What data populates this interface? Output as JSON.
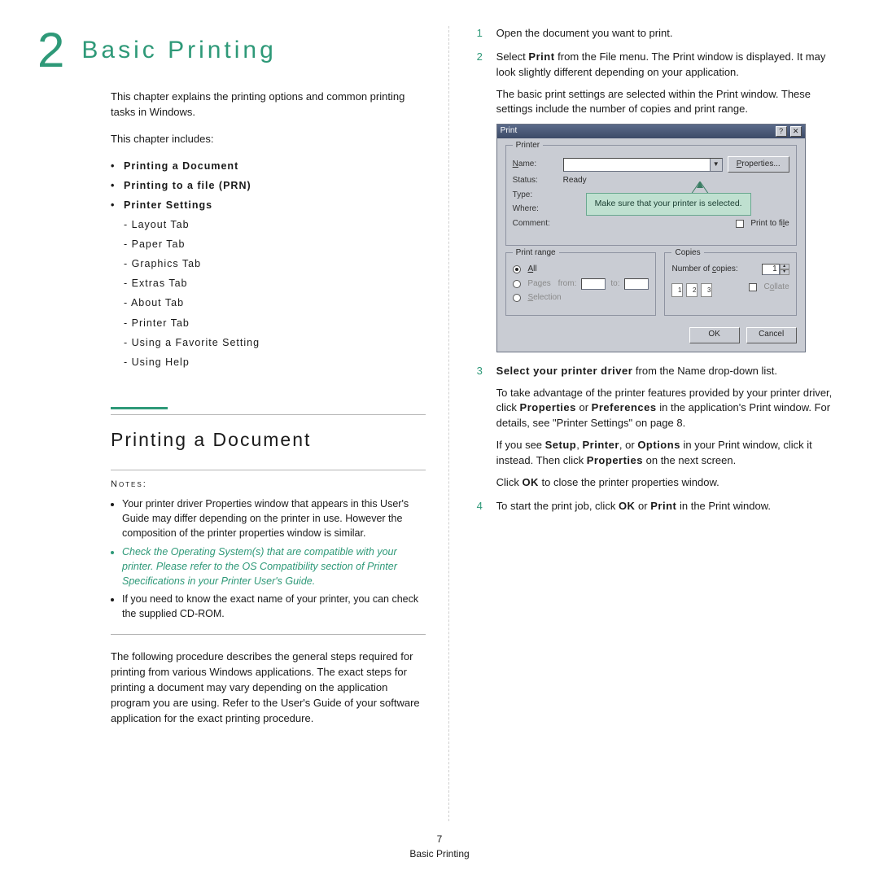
{
  "chapter": {
    "number": "2",
    "title": "Basic Printing"
  },
  "intro": "This chapter explains the printing options and common printing tasks in Windows.",
  "includes_label": "This chapter includes:",
  "toc": [
    "Printing a Document",
    "Printing to a file (PRN)",
    "Printer Settings"
  ],
  "toc_sub": [
    "Layout Tab",
    "Paper Tab",
    "Graphics Tab",
    "Extras Tab",
    "About Tab",
    "Printer Tab",
    "Using a Favorite Setting",
    "Using Help"
  ],
  "section_title": "Printing a Document",
  "notes": {
    "label": "Notes:",
    "items": {
      "a": "Your printer driver Properties window that appears in this User's Guide may differ depending on the printer in use. However the composition of the printer properties window is similar.",
      "b": "Check the Operating System(s) that are compatible with your printer. Please refer to the OS Compatibility section of Printer Specifications in your Printer User's Guide.",
      "c": "If you need to know the exact name of your printer, you can check the supplied CD-ROM."
    }
  },
  "following": "The following procedure describes the general steps required for printing from various Windows applications. The exact steps for printing a document may vary depending on the application program you are using. Refer to the User's Guide of your software application for the exact printing procedure.",
  "steps": {
    "n1": "1",
    "n2": "2",
    "n3": "3",
    "n4": "4",
    "s1": "Open the document you want to print.",
    "s2a_pre": "Select ",
    "s2a_b": "Print",
    "s2a_post": " from the File menu. The Print window is displayed. It may look slightly different depending on your application.",
    "s2b": "The basic print settings are selected within the Print window. These settings include the number of copies and print range.",
    "s3a_pre": "Select your printer driver",
    "s3a_post": " from the Name drop-down list.",
    "s3b_pre": "To take advantage of the printer features provided by your printer driver, click ",
    "s3b_b1": "Properties",
    "s3b_mid": " or ",
    "s3b_b2": "Preferences",
    "s3b_post": " in the application's Print window. For details, see \"Printer Settings\" on page 8.",
    "s3c_pre": "If you see ",
    "s3c_b1": "Setup",
    "s3c_c": ", ",
    "s3c_b2": "Printer",
    "s3c_c2": ", or ",
    "s3c_b3": "Options",
    "s3c_post": " in your Print window, click it instead. Then click ",
    "s3c_b4": "Properties",
    "s3c_end": " on the next screen.",
    "s3d_pre": "Click ",
    "s3d_b": "OK",
    "s3d_post": " to close the printer properties window.",
    "s4_pre": "To start the print job, click ",
    "s4_b1": "OK",
    "s4_mid": " or ",
    "s4_b2": "Print",
    "s4_post": " in the Print window."
  },
  "dialog": {
    "title": "Print",
    "printer_legend": "Printer",
    "labels": {
      "name": "Name:",
      "status": "Status:",
      "type": "Type:",
      "where": "Where:",
      "comment": "Comment:"
    },
    "status_value": "Ready",
    "properties_btn": "Properties...",
    "print_to_file": "Print to file",
    "callout": "Make sure that your printer is selected.",
    "range_legend": "Print range",
    "range": {
      "all": "All",
      "pages": "Pages",
      "from": "from:",
      "to": "to:",
      "selection": "Selection"
    },
    "copies_legend": "Copies",
    "copies_label": "Number of copies:",
    "copies_value": "1",
    "collate": "Collate",
    "sheets": [
      "1",
      "2",
      "3"
    ],
    "ok": "OK",
    "cancel": "Cancel",
    "help": "?",
    "close": "✕"
  },
  "footer": {
    "page": "7",
    "title": "Basic Printing"
  }
}
